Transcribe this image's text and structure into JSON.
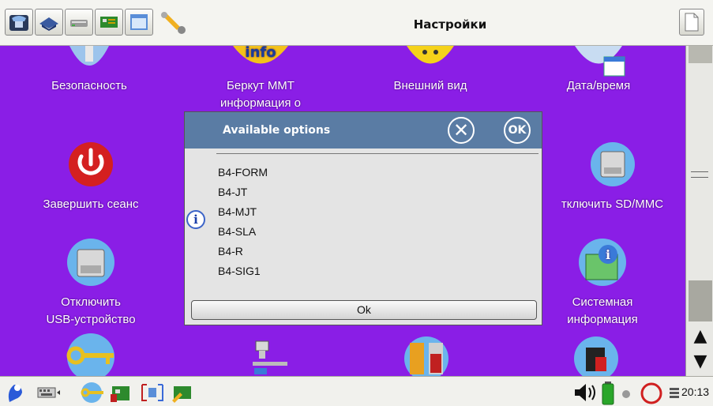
{
  "window": {
    "title": "Настройки"
  },
  "toolbar": {
    "apps": [
      "phone-app-icon",
      "hat-app-icon",
      "modem-app-icon",
      "card-app-icon",
      "window-app-icon",
      "wrench-app-icon"
    ]
  },
  "desktop": {
    "row1": [
      "Безопасность",
      "Беркут ММТ\nинформация о",
      "Внешний вид",
      "Дата/время"
    ],
    "row2": [
      "Завершить сеанс",
      "тключить SD/MMC"
    ],
    "row3": [
      "Отключить\nUSB-устройство",
      "Системная\nинформация"
    ]
  },
  "dialog": {
    "title": "Available options",
    "close_symbol": "⊗",
    "ok_symbol": "OK",
    "options": [
      "B4-FORM",
      "B4-JT",
      "B4-MJT",
      "B4-SLA",
      "B4-R",
      "B4-SIG1"
    ],
    "info_symbol": "i",
    "ok_button": "Ok"
  },
  "scrollbar": {
    "up": "▲",
    "down": "▼"
  },
  "taskbar": {
    "time": "20:13"
  },
  "colors": {
    "desktop": "#8a1ee6",
    "dialog_header": "#5a7ca4"
  }
}
